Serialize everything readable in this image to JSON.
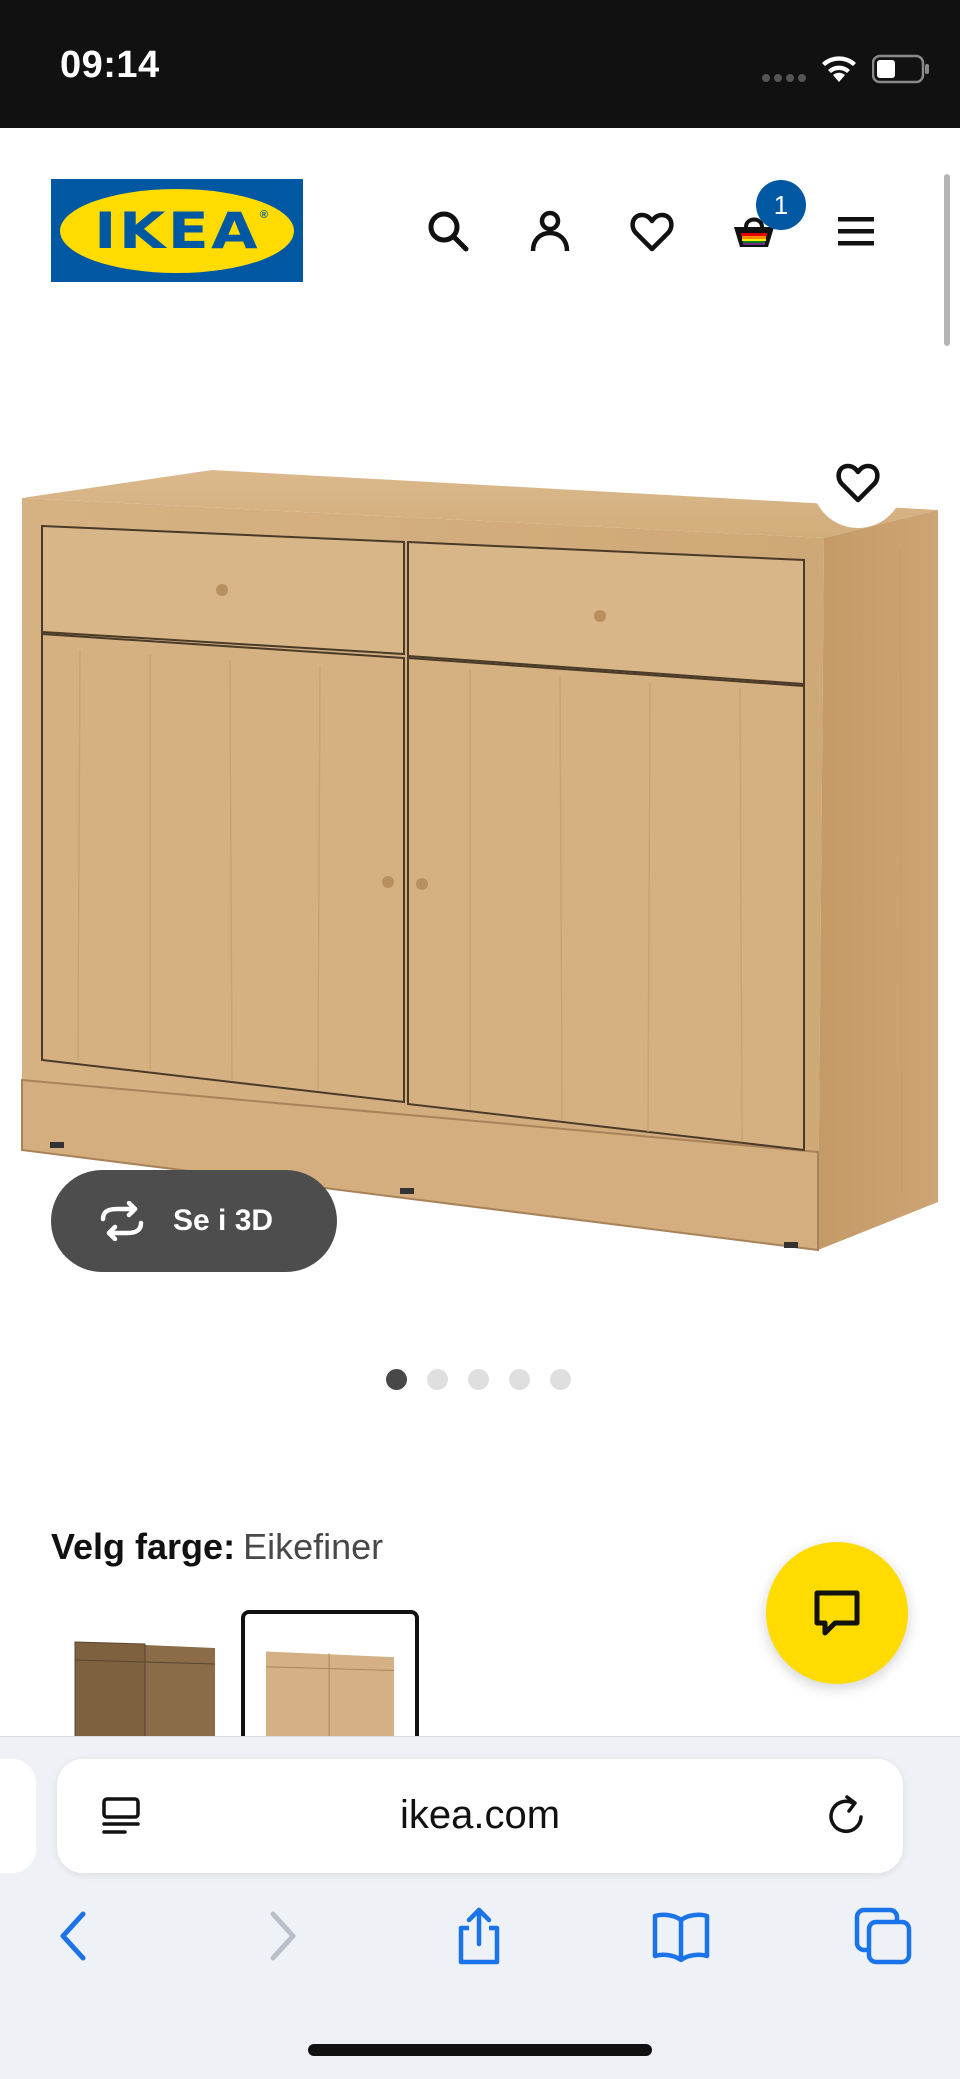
{
  "status_bar": {
    "time": "09:14"
  },
  "header": {
    "logo_text": "IKEA",
    "logo_reg": "®",
    "icons": [
      "search-icon",
      "account-icon",
      "wishlist-icon",
      "cart-icon",
      "menu-icon"
    ],
    "cart_count": "1"
  },
  "product": {
    "view_3d_label": "Se i 3D",
    "image_count": 5,
    "active_image": 1
  },
  "color_select": {
    "label": "Velg farge:",
    "value": "Eikefiner",
    "swatches": [
      "dark-oak",
      "oak-veneer"
    ],
    "selected_swatch": 2
  },
  "browser": {
    "url": "ikea.com"
  },
  "colors": {
    "ikea_blue": "#0058a3",
    "ikea_yellow": "#ffdb00",
    "safari_blue": "#1a73e8"
  }
}
